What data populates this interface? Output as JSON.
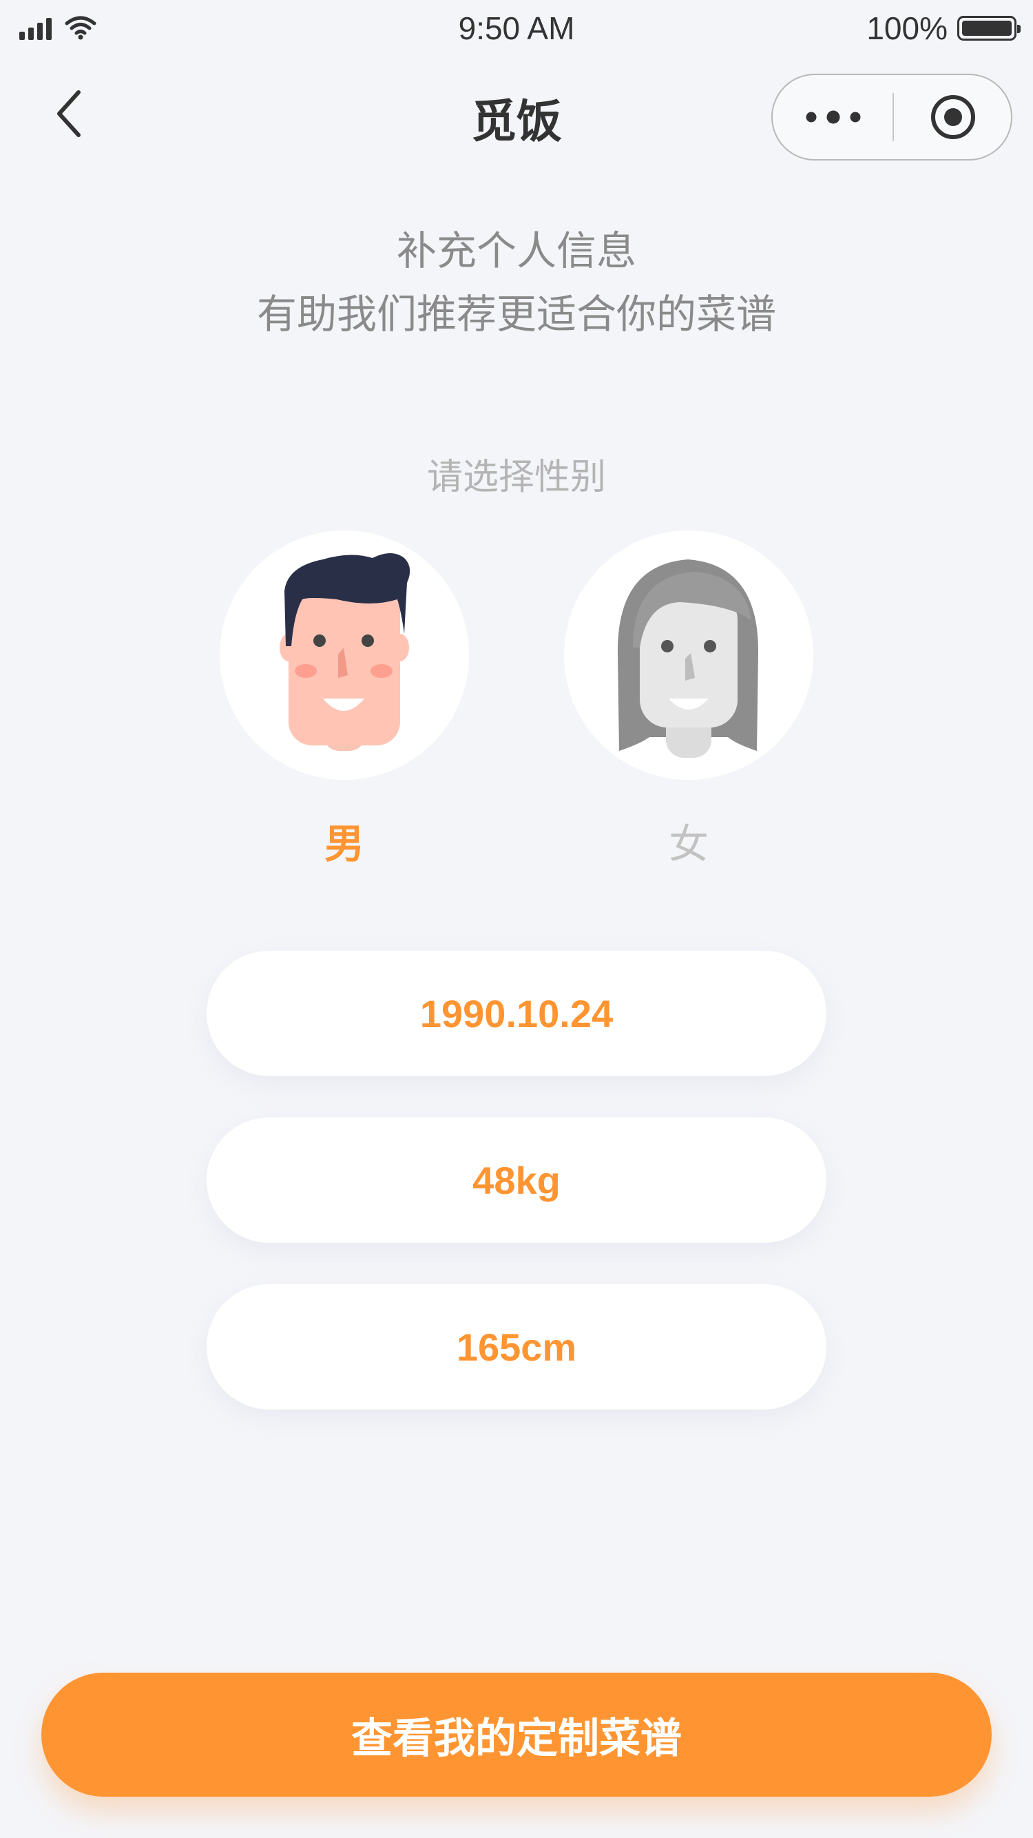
{
  "status_bar": {
    "time": "9:50 AM",
    "battery": "100%",
    "icons": [
      "signal-icon",
      "wifi-icon",
      "battery-icon"
    ]
  },
  "nav": {
    "title": "觅饭",
    "icons": [
      "back-icon",
      "more-icon",
      "close-target-icon"
    ]
  },
  "intro": {
    "line1": "补充个人信息",
    "line2": "有助我们推荐更适合你的菜谱"
  },
  "gender": {
    "prompt": "请选择性别",
    "options": [
      {
        "label": "男",
        "selected": true,
        "icon": "male-avatar-icon"
      },
      {
        "label": "女",
        "selected": false,
        "icon": "female-avatar-icon"
      }
    ]
  },
  "fields": {
    "birthday": "1990.10.24",
    "weight": "48kg",
    "height": "165cm"
  },
  "cta": {
    "label": "查看我的定制菜谱"
  },
  "colors": {
    "accent": "#ff9532",
    "background": "#f4f5f9",
    "muted_text": "#8a8a8a",
    "inactive_text": "#c2c2c2"
  }
}
